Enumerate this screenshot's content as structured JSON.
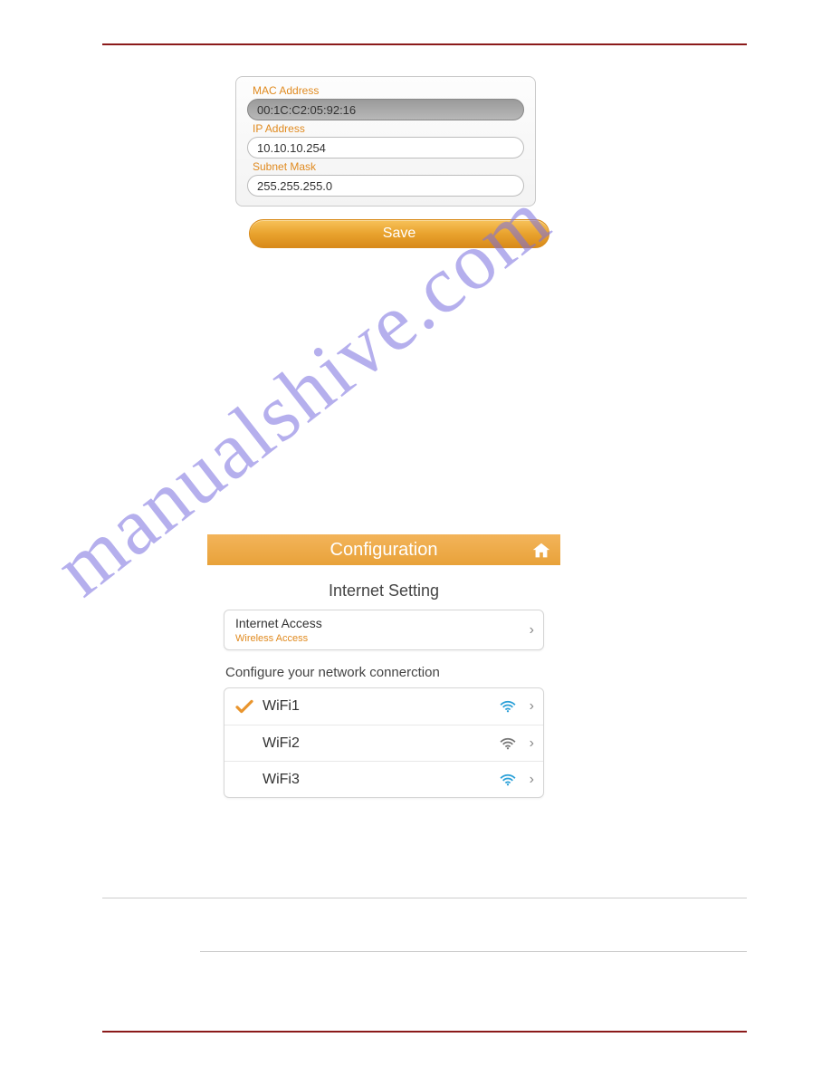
{
  "panel1": {
    "mac_label": "MAC Address",
    "mac_value": "00:1C:C2:05:92:16",
    "ip_label": "IP Address",
    "ip_value": "10.10.10.254",
    "subnet_label": "Subnet Mask",
    "subnet_value": "255.255.255.0",
    "save_label": "Save"
  },
  "watermark": "manualshive.com",
  "config": {
    "header": "Configuration",
    "section1_title": "Internet  Setting",
    "access_row": {
      "main": "Internet Access",
      "sub": "Wireless Access"
    },
    "section2_title": "Configure your network connerction",
    "networks": [
      {
        "name": "WiFi1",
        "selected": true,
        "signal_color": "#2aa0d8"
      },
      {
        "name": "WiFi2",
        "selected": false,
        "signal_color": "#777"
      },
      {
        "name": "WiFi3",
        "selected": false,
        "signal_color": "#2aa0d8"
      }
    ]
  }
}
